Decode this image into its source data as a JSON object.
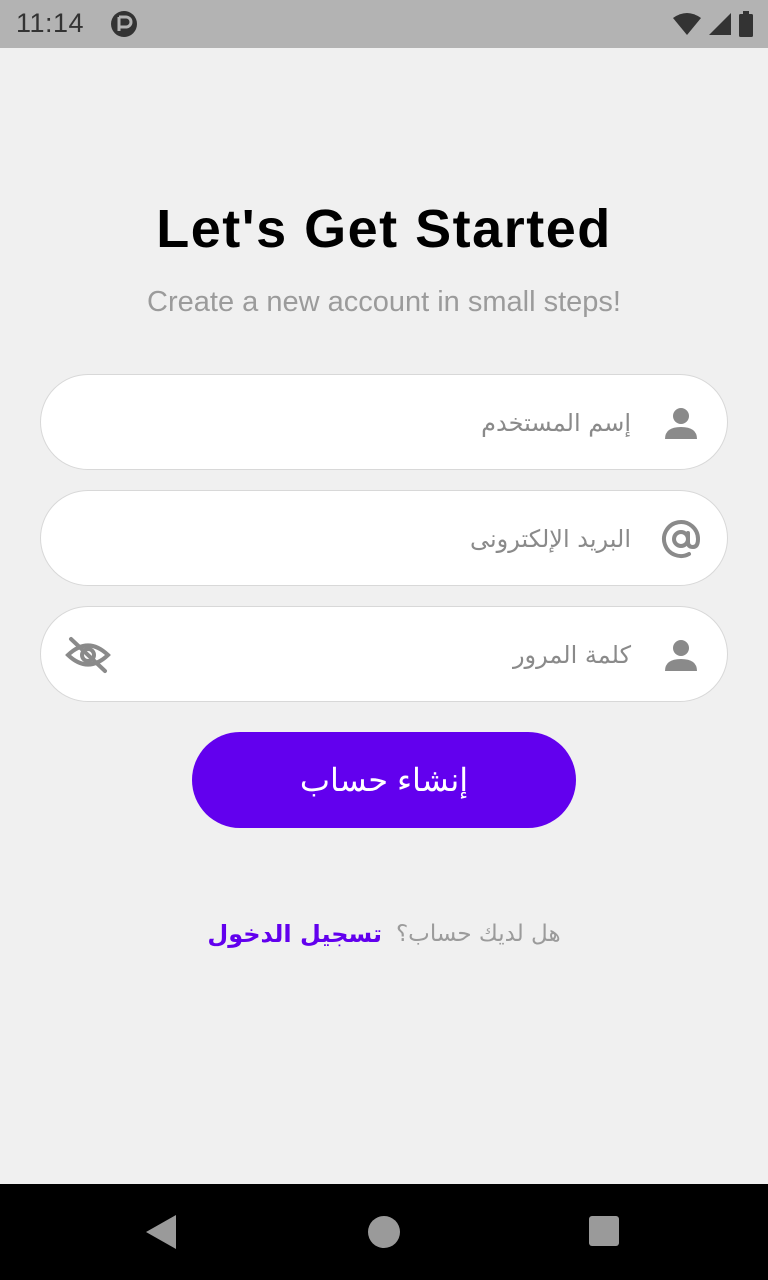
{
  "status_bar": {
    "time": "11:14",
    "icons": [
      "app-icon",
      "wifi-icon",
      "signal-icon",
      "battery-icon"
    ]
  },
  "header": {
    "title": "Let's Get Started",
    "subtitle": "Create a new account in small steps!"
  },
  "form": {
    "username": {
      "placeholder": "إسم المستخدم",
      "icon": "person-icon"
    },
    "email": {
      "placeholder": "البريد الإلكترونى",
      "icon": "at-icon"
    },
    "password": {
      "placeholder": "كلمة المرور",
      "icon": "person-icon",
      "toggle_icon": "eye-off-icon"
    },
    "submit_label": "إنشاء حساب"
  },
  "footer": {
    "question": "هل لديك حساب؟",
    "login_label": "تسجيل الدخول"
  },
  "colors": {
    "primary": "#6200ee",
    "background": "#f0f0f0",
    "placeholder": "#8a8a8a",
    "subtitle": "#9b9b9b"
  },
  "nav_bar": {
    "icons": [
      "back-icon",
      "home-icon",
      "recents-icon"
    ]
  }
}
